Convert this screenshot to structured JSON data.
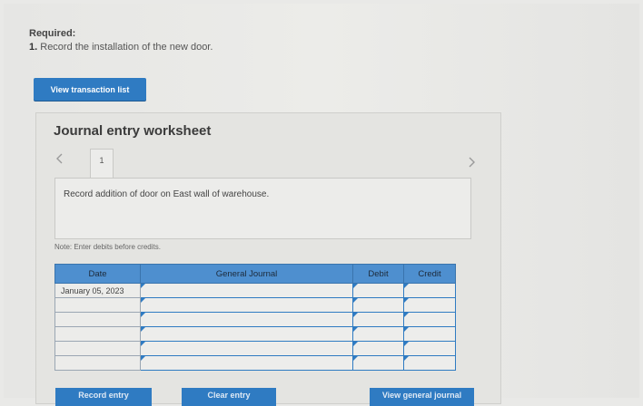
{
  "required": {
    "title": "Required:",
    "item_number": "1.",
    "item_text": " Record the installation of the new door."
  },
  "view_transaction_list_label": "View transaction list",
  "worksheet": {
    "title": "Journal entry worksheet",
    "prev_icon": "chevron-left-icon",
    "next_icon": "chevron-right-icon",
    "active_tab": "1",
    "description": "Record addition of door on East wall of warehouse.",
    "note": "Note: Enter debits before credits."
  },
  "table": {
    "headers": {
      "date": "Date",
      "general_journal": "General Journal",
      "debit": "Debit",
      "credit": "Credit"
    },
    "rows": [
      {
        "date": "January 05, 2023",
        "account": "",
        "debit": "",
        "credit": ""
      },
      {
        "date": "",
        "account": "",
        "debit": "",
        "credit": ""
      },
      {
        "date": "",
        "account": "",
        "debit": "",
        "credit": ""
      },
      {
        "date": "",
        "account": "",
        "debit": "",
        "credit": ""
      },
      {
        "date": "",
        "account": "",
        "debit": "",
        "credit": ""
      },
      {
        "date": "",
        "account": "",
        "debit": "",
        "credit": ""
      }
    ]
  },
  "buttons": {
    "record_entry": "Record entry",
    "clear_entry": "Clear entry",
    "view_general_journal": "View general journal"
  },
  "colors": {
    "accent": "#2f7bc2",
    "header_fill": "#4e8fcf"
  }
}
